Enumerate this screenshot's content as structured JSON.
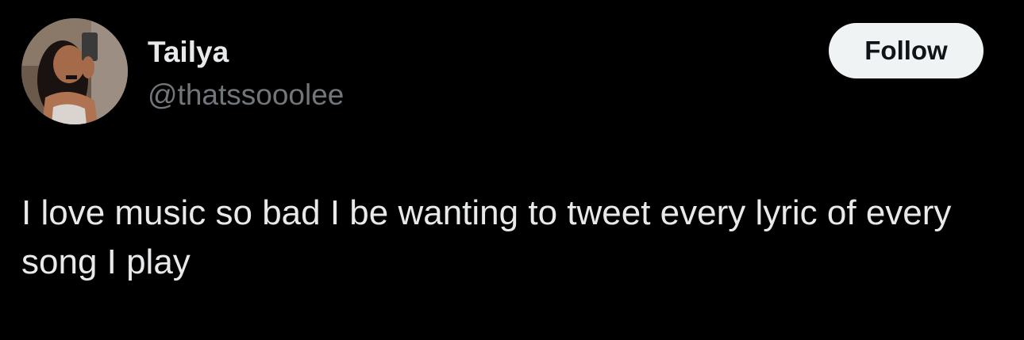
{
  "author": {
    "name": "Tailya",
    "handle": "@thatssooolee",
    "avatar_icon": "profile-photo"
  },
  "actions": {
    "follow_label": "Follow"
  },
  "tweet": {
    "text": "I love music so bad I be wanting to tweet every lyric of every song I play"
  },
  "colors": {
    "background": "#000000",
    "primary_text": "#e7e9ea",
    "secondary_text": "#71767b",
    "follow_button_bg": "#eff3f4",
    "follow_button_text": "#0f1419"
  }
}
